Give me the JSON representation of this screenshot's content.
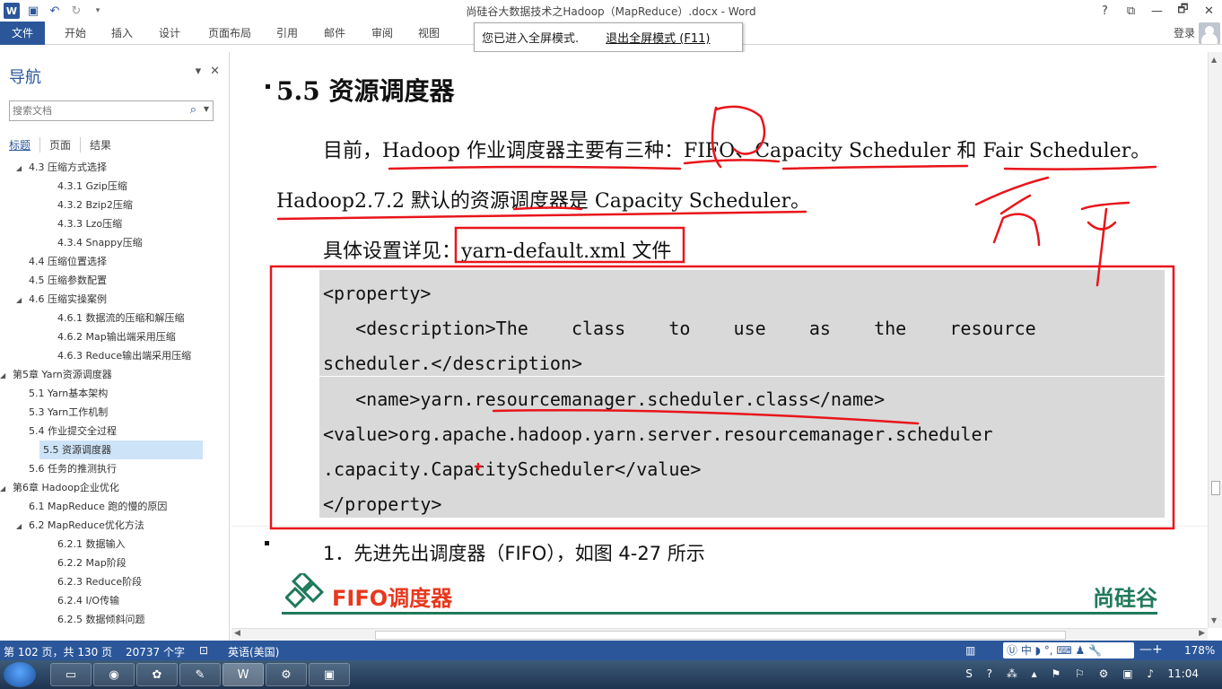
{
  "window": {
    "title": "尚硅谷大数据技术之Hadoop（MapReduce）.docx - Word",
    "controls": [
      "?",
      "⧉",
      "—",
      "🗗",
      "✕"
    ]
  },
  "quick_access": {
    "icons": [
      "word-logo",
      "save-icon",
      "undo-icon",
      "redo-icon",
      "customize-icon"
    ]
  },
  "ribbon": {
    "tabs": [
      "文件",
      "开始",
      "插入",
      "设计",
      "页面布局",
      "引用",
      "邮件",
      "审阅",
      "视图"
    ],
    "login": "登录"
  },
  "fullscreen_notice": {
    "text": "您已进入全屏模式.",
    "exit": "退出全屏模式 (F11)"
  },
  "nav": {
    "title": "导航",
    "search_placeholder": "搜索文档",
    "tabs": [
      "标题",
      "页面",
      "结果"
    ],
    "items": [
      {
        "label": "4.3 压缩方式选择",
        "level": 2,
        "expanded": true
      },
      {
        "label": "4.3.1 Gzip压缩",
        "level": 3
      },
      {
        "label": "4.3.2 Bzip2压缩",
        "level": 3
      },
      {
        "label": "4.3.3 Lzo压缩",
        "level": 3
      },
      {
        "label": "4.3.4 Snappy压缩",
        "level": 3
      },
      {
        "label": "4.4 压缩位置选择",
        "level": 2
      },
      {
        "label": "4.5 压缩参数配置",
        "level": 2
      },
      {
        "label": "4.6 压缩实操案例",
        "level": 2,
        "expanded": true
      },
      {
        "label": "4.6.1 数据流的压缩和解压缩",
        "level": 3
      },
      {
        "label": "4.6.2 Map输出端采用压缩",
        "level": 3
      },
      {
        "label": "4.6.3 Reduce输出端采用压缩",
        "level": 3
      },
      {
        "label": "第5章 Yarn资源调度器",
        "level": 1,
        "expanded": true
      },
      {
        "label": "5.1 Yarn基本架构",
        "level": 2
      },
      {
        "label": "5.3 Yarn工作机制",
        "level": 2
      },
      {
        "label": "5.4 作业提交全过程",
        "level": 2
      },
      {
        "label": "5.5 资源调度器",
        "level": 2,
        "selected": true
      },
      {
        "label": "5.6 任务的推测执行",
        "level": 2
      },
      {
        "label": "第6章 Hadoop企业优化",
        "level": 1,
        "expanded": true
      },
      {
        "label": "6.1 MapReduce 跑的慢的原因",
        "level": 2
      },
      {
        "label": "6.2 MapReduce优化方法",
        "level": 2,
        "expanded": true
      },
      {
        "label": "6.2.1 数据输入",
        "level": 3
      },
      {
        "label": "6.2.2 Map阶段",
        "level": 3
      },
      {
        "label": "6.2.3 Reduce阶段",
        "level": 3
      },
      {
        "label": "6.2.4 I/O传输",
        "level": 3
      },
      {
        "label": "6.2.5 数据倾斜问题",
        "level": 3
      }
    ]
  },
  "document": {
    "heading": "5.5  资源调度器",
    "para1": "目前，Hadoop 作业调度器主要有三种：FIFO、Capacity Scheduler 和 Fair Scheduler。",
    "para2": "Hadoop2.7.2 默认的资源调度器是 Capacity Scheduler。",
    "para3_prefix": "具体设置详见：",
    "para3_file": "yarn-default.xml 文件",
    "code_lines": [
      "<property>",
      "   <description>The    class    to    use    as    the    resource",
      "scheduler.</description>",
      "   <name>yarn.resourcemanager.scheduler.class</name>",
      "<value>org.apache.hadoop.yarn.server.resourcemanager.scheduler",
      ".capacity.CapacityScheduler</value>",
      "</property>"
    ],
    "section1": "1．先进先出调度器（FIFO），如图 4-27 所示",
    "banner_title": "FIFO调度器",
    "brand": "尚硅谷"
  },
  "status_bar": {
    "page": "第 102 页，共 130 页",
    "words": "20737 个字",
    "language": "英语(美国)",
    "zoom": "178%"
  },
  "taskbar": {
    "time": "11:04"
  },
  "colors": {
    "word_blue": "#2b579a",
    "annotation_red": "#e8151b",
    "code_bg": "#d9d9d9",
    "brand_green": "#1f7a5a"
  }
}
